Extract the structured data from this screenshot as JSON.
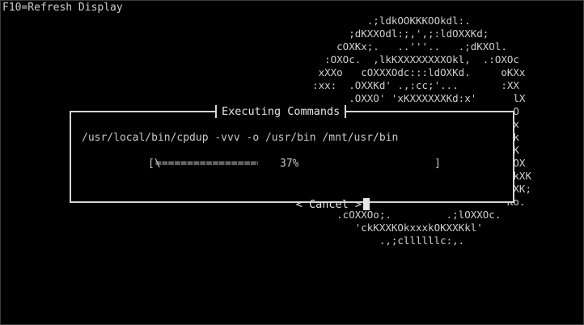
{
  "console": {
    "background": "#000000",
    "foreground": "#c8c8c8",
    "hint": "F10=Refresh Display"
  },
  "logo": {
    "lines": [
      "           .;ldkOOKKKOOkdl:.",
      "        ;dKXXOdl:;,',;:ldOXXKd;",
      "      cOXKx;.   ..'''..   .;dKXOl.",
      "    :OXOc.  ,lkKXXXXXXXXOkl,  .:OXOc",
      "   xXXo   cOXXXOdc:::ldOXKd.     oKXx",
      "  :xx:  .OXXKd' .,:cc;'...       :XX",
      "        .OXXO' 'xKXXXXXXKd:x'      lX",
      "                                   O",
      "                                   x",
      "                                   k",
      "                                  'K",
      "                                  .OX",
      "                                  .kXK",
      "                                  OXK;",
      "                                  Ko.",
      "      .cOXXOo;.         .;lOXXOc.",
      "         'ckKXXKOkxxxkOKXXKkl'",
      "             .,;cllllllc:,."
    ]
  },
  "dialog": {
    "title": "Executing Commands",
    "command": "/usr/local/bin/cpdup -vvv -o /usr/bin /mnt/usr/bin",
    "progress": {
      "percent": 37,
      "percent_label": "37%",
      "open_bracket": "[\\",
      "close_bracket": "]",
      "fill_chars": "=================================================="
    },
    "cancel_label": "< Cancel >"
  }
}
